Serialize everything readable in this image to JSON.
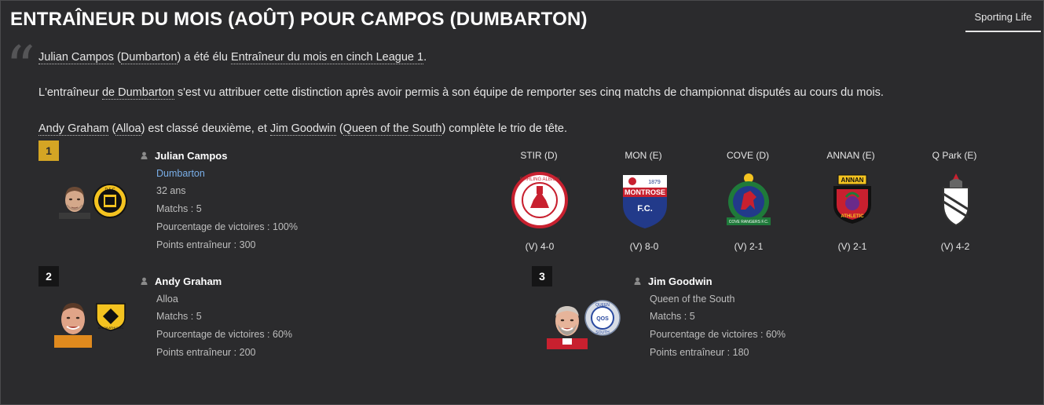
{
  "title": "ENTRAÎNEUR DU MOIS (AOÛT) POUR CAMPOS (DUMBARTON)",
  "source_tab": "Sporting Life",
  "paragraphs": {
    "p1": {
      "l1": "Julian Campos",
      "t1": " (",
      "l2": "Dumbarton",
      "t2": ") a été élu ",
      "l3": "Entraîneur du mois en cinch League 1",
      "t3": "."
    },
    "p2": {
      "t1": "L'entraîneur ",
      "l1": "de Dumbarton",
      "t2": " s'est vu attribuer cette distinction après avoir permis à son équipe de remporter ses cinq matchs de championnat disputés au cours du mois."
    },
    "p3": {
      "l1": "Andy Graham",
      "t1": " (",
      "l2": "Alloa",
      "t2": ") est classé deuxième, et ",
      "l3": "Jim Goodwin",
      "t3": " (",
      "l4": "Queen of the South",
      "t4": ") complète le trio de tête."
    }
  },
  "winners": [
    {
      "rank": "1",
      "name": "Julian Campos",
      "club": "Dumbarton",
      "age": "32 ans",
      "matches": "Matchs : 5",
      "win_pct": "Pourcentage de victoires : 100%",
      "points": "Points entraîneur : 300"
    },
    {
      "rank": "2",
      "name": "Andy Graham",
      "club": "Alloa",
      "matches": "Matchs : 5",
      "win_pct": "Pourcentage de victoires : 60%",
      "points": "Points entraîneur : 200"
    },
    {
      "rank": "3",
      "name": "Jim Goodwin",
      "club": "Queen of the South",
      "matches": "Matchs : 5",
      "win_pct": "Pourcentage de victoires : 60%",
      "points": "Points entraîneur : 180"
    }
  ],
  "opponents": [
    {
      "label": "STIR (D)",
      "result": "(V) 4-0",
      "badge_text": "STIRLING ALBION"
    },
    {
      "label": "MON (E)",
      "result": "(V) 8-0",
      "badge_text": "MONTROSE",
      "badge_text2": "F.C.",
      "badge_year": "1879"
    },
    {
      "label": "COVE (D)",
      "result": "(V) 2-1",
      "badge_text": "COVE RANGERS F.C."
    },
    {
      "label": "ANNAN (E)",
      "result": "(V) 2-1",
      "badge_text": "ANNAN",
      "badge_text2": "ATHLETIC"
    },
    {
      "label": "Q Park (E)",
      "result": "(V) 4-2"
    }
  ],
  "badges": {
    "dumbarton": "D F C",
    "alloa": "ALLOA ATHLETIC",
    "qots_top": "QUEEN",
    "qots_mid": "QOS",
    "qots_bot": "SOUTH"
  },
  "colors": {
    "rank_gold": "#d4a524",
    "link_blue": "#79aee8",
    "background": "#2b2b2d"
  }
}
